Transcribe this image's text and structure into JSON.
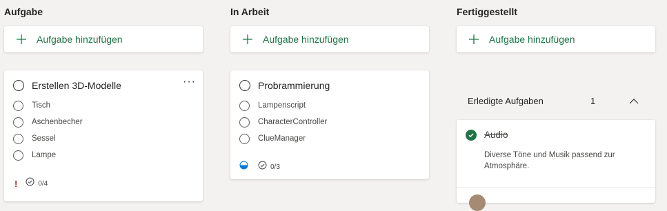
{
  "columns": [
    {
      "title": "Aufgabe",
      "add_label": "Aufgabe hinzufügen",
      "card": {
        "title": "Erstellen 3D-Modelle",
        "more": "···",
        "items": [
          "Tisch",
          "Aschenbecher",
          "Sessel",
          "Lampe"
        ],
        "priority": "!",
        "checklist_count": "0/4",
        "priority_color": "#a4262c"
      }
    },
    {
      "title": "In Arbeit",
      "add_label": "Aufgabe hinzufügen",
      "card": {
        "title": "Probrammierung",
        "items": [
          "Lampenscript",
          "CharacterController",
          "ClueManager"
        ],
        "checklist_count": "0/3",
        "progress_icon": "half-circle-progress-icon"
      }
    },
    {
      "title": "Fertiggestellt",
      "add_label": "Aufgabe hinzufügen",
      "completed": {
        "label": "Erledigte Aufgaben",
        "count": "1",
        "task_title": "Audio",
        "task_description": "Diverse Töne und Musik passend zur Atmosphäre."
      }
    }
  ],
  "colors": {
    "accent_green": "#217346",
    "progress_blue": "#0078d4"
  }
}
